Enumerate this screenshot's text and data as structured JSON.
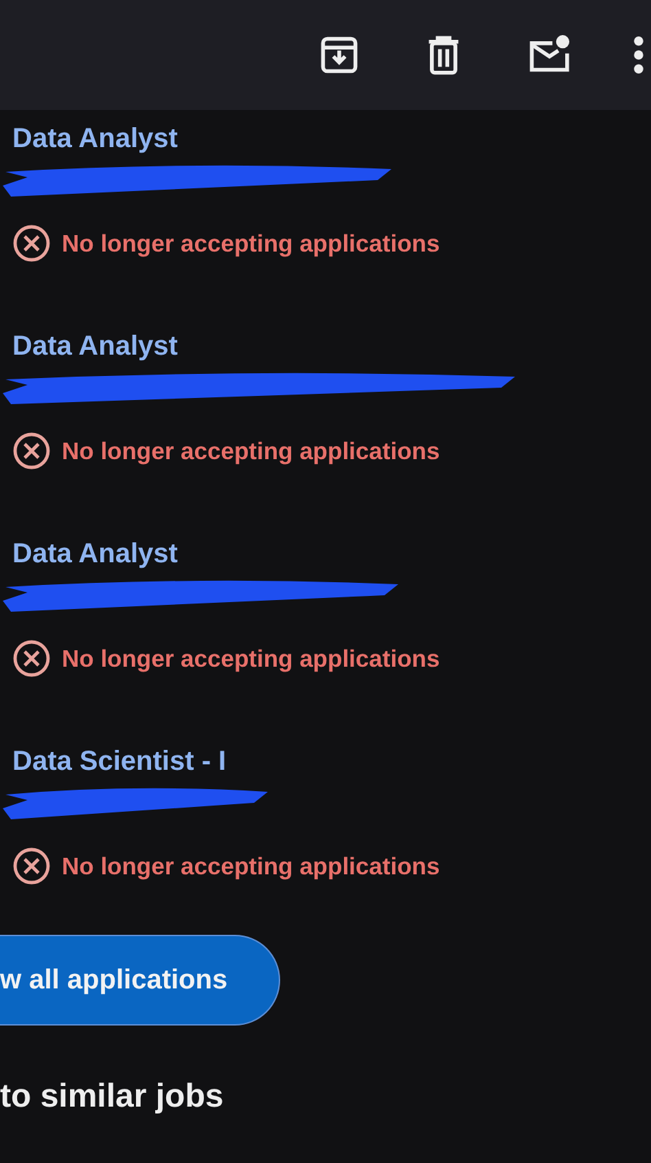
{
  "toolbar": {
    "actions": [
      {
        "kind": "archive"
      },
      {
        "kind": "delete"
      },
      {
        "kind": "mail",
        "unread": true
      },
      {
        "kind": "more"
      }
    ]
  },
  "jobs": [
    {
      "title": "Data Analyst",
      "redacted": true,
      "status": "No longer accepting applications"
    },
    {
      "title": "Data Analyst",
      "redacted": true,
      "status": "No longer accepting applications"
    },
    {
      "title": "Data Analyst",
      "redacted": true,
      "status": "No longer accepting applications"
    },
    {
      "title": "Data Scientist - I",
      "redacted": true,
      "status": "No longer accepting applications"
    }
  ],
  "view_button": {
    "label": "w all applications"
  },
  "section_heading": "to similar jobs"
}
